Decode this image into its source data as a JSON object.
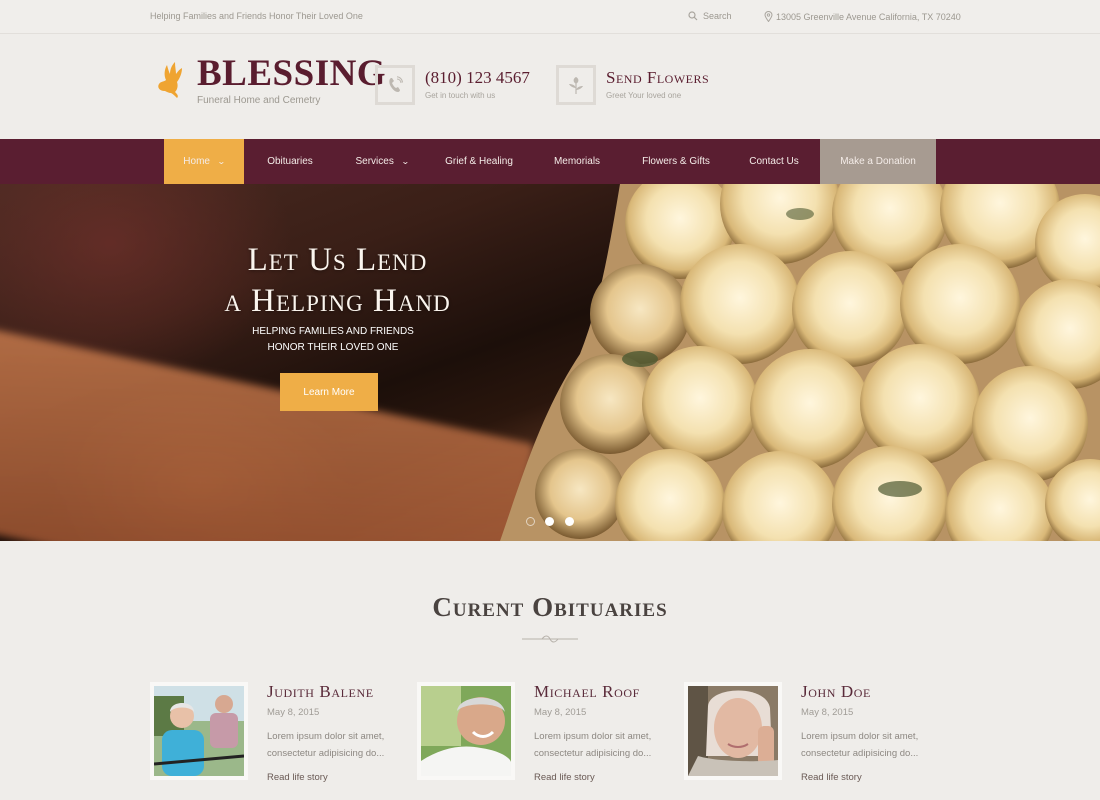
{
  "topbar": {
    "tagline": "Helping Families and Friends Honor Their Loved One",
    "search_label": "Search",
    "search_icon": "search-icon",
    "address_icon": "map-pin-icon",
    "address": "13005 Greenville Avenue California, TX 70240"
  },
  "header": {
    "logo_icon": "dove-icon",
    "logo_title": "BLESSING",
    "logo_subtitle": "Funeral Home and Cemetry",
    "phone": {
      "icon": "phone-icon",
      "title": "(810) 123 4567",
      "subtitle": "Get in touch with us"
    },
    "flowers": {
      "icon": "flower-icon",
      "title": "Send Flowers",
      "subtitle": "Greet Your loved one"
    }
  },
  "nav": {
    "items": [
      {
        "label": "Home",
        "has_dropdown": true,
        "active": true
      },
      {
        "label": "Obituaries",
        "has_dropdown": false
      },
      {
        "label": "Services",
        "has_dropdown": true
      },
      {
        "label": "Grief & Healing",
        "has_dropdown": false
      },
      {
        "label": "Memorials",
        "has_dropdown": false
      },
      {
        "label": "Flowers & Gifts",
        "has_dropdown": false
      },
      {
        "label": "Contact Us",
        "has_dropdown": false
      },
      {
        "label": "Make a Donation",
        "has_dropdown": false
      }
    ],
    "chevron": "⌄"
  },
  "hero": {
    "title_line1": "Let Us Lend",
    "title_line2": "a Helping Hand",
    "subtitle_line1": "Helping families and friends",
    "subtitle_line2": "honor their loved one",
    "button_label": "Learn More",
    "slides_total": 3,
    "slide_active": 2
  },
  "obituaries": {
    "title": "Curent Obituaries",
    "items": [
      {
        "name": "Judith Balene",
        "date": "May 8, 2015",
        "excerpt": "Lorem ipsum dolor sit amet, consectetur adipisicing do...",
        "link": "Read life story"
      },
      {
        "name": "Michael Roof",
        "date": "May 8, 2015",
        "excerpt": "Lorem ipsum dolor sit amet, consectetur adipisicing do...",
        "link": "Read life story"
      },
      {
        "name": "John Doe",
        "date": "May 8, 2015",
        "excerpt": "Lorem ipsum dolor sit amet, consectetur adipisicing do...",
        "link": "Read life story"
      }
    ]
  },
  "colors": {
    "brand": "#5a1e31",
    "accent": "#efae47",
    "donate": "#a79b91",
    "background": "#efedea"
  }
}
